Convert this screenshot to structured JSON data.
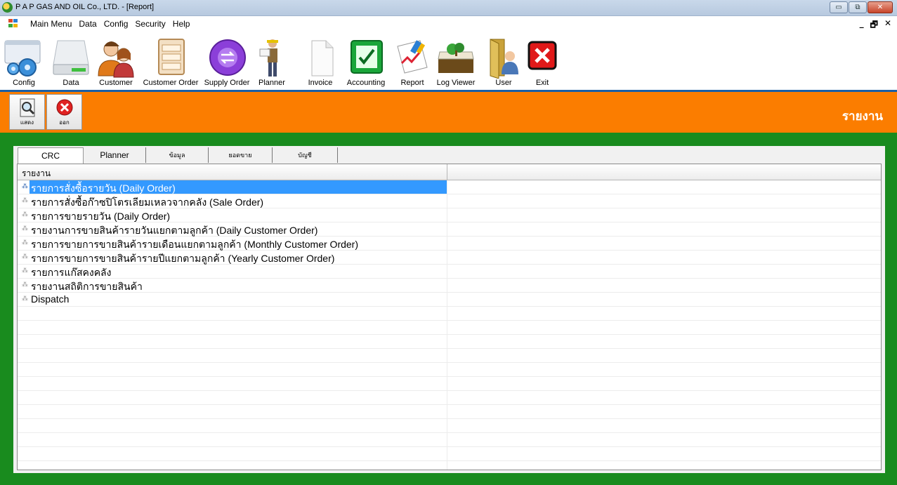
{
  "window": {
    "title": "P A P GAS AND OIL Co., LTD. - [Report]",
    "minimize_glyph": "▭",
    "restore_glyph": "⧉",
    "close_glyph": "✕"
  },
  "menubar": {
    "items": [
      "Main Menu",
      "Data",
      "Config",
      "Security",
      "Help"
    ],
    "mdi_minimize": "_",
    "mdi_restore": "🗗",
    "mdi_close": "✕"
  },
  "toolbar": {
    "items": [
      {
        "label": "Config",
        "icon": "config-gear-icon"
      },
      {
        "label": "Data",
        "icon": "hard-drive-icon"
      },
      {
        "label": "Customer",
        "icon": "customer-people-icon"
      },
      {
        "label": "Customer Order",
        "icon": "order-cabinet-icon"
      },
      {
        "label": "Supply Order",
        "icon": "supply-exchange-icon"
      },
      {
        "label": "Planner",
        "icon": "planner-worker-icon"
      },
      {
        "label": "Invoice",
        "icon": "invoice-document-icon"
      },
      {
        "label": "Accounting",
        "icon": "accounting-check-icon"
      },
      {
        "label": "Report",
        "icon": "report-chart-icon"
      },
      {
        "label": "Log Viewer",
        "icon": "log-viewer-icon"
      },
      {
        "label": "User",
        "icon": "user-door-icon"
      },
      {
        "label": "Exit",
        "icon": "exit-x-icon"
      }
    ]
  },
  "actionbar": {
    "show_label": "แสดง",
    "exit_label": "ออก",
    "heading": "รายงาน",
    "accent": "#fb7d00"
  },
  "tabs": [
    "CRC",
    "Planner",
    "ข้อมูล",
    "ยอดขาย",
    "บัญชี"
  ],
  "active_tab": "CRC",
  "report_list": {
    "column_header": "รายงาน",
    "items": [
      "รายการสั่งซื้อรายวัน (Daily Order)",
      "รายการสั่งซื้อก๊าซปิโตรเลียมเหลวจากคลัง (Sale Order)",
      "รายการขายรายวัน (Daily Order)",
      "รายงานการขายสินค้ารายวันแยกตามลูกค้า (Daily Customer Order)",
      "รายการขายการขายสินค้ารายเดือนแยกตามลูกค้า (Monthly Customer Order)",
      "รายการขายการขายสินค้ารายปีแยกตามลูกค้า (Yearly Customer Order)",
      "รายการแก๊สคงคลัง",
      "รายงานสถิติการขายสินค้า",
      "Dispatch"
    ],
    "selected_index": 0
  },
  "colors": {
    "frame_green": "#198b1e",
    "selection_blue": "#3399ff",
    "toolbar_separator": "#1a5fa6"
  }
}
